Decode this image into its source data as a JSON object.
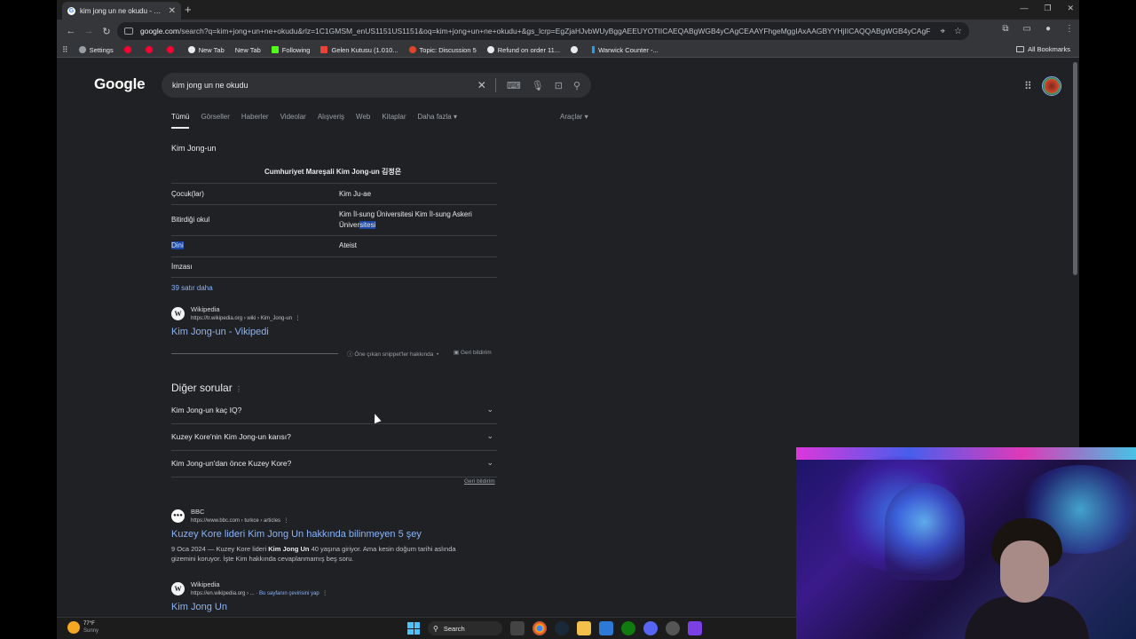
{
  "browser": {
    "tab_title": "kim jong un ne okudu - Google S",
    "url_host": "google.com",
    "url_rest": "/search?q=kim+jong+un+ne+okudu&rlz=1C1GMSM_enUS1151US1151&oq=kim+jong+un+ne+okudu+&gs_lcrp=EgZjaHJvbWUyBggAEEUYOTIICAEQABgWGB4yCAgCEAAYFhgeMggIAxAAGBYYHjIICAQQABgWGB4yCAgFEAAYFhgeMgcIBhAAGO8FM...",
    "bookmarks": [
      {
        "label": "Settings",
        "color": "#9aa0a6"
      },
      {
        "label": "",
        "color": "#ff0033"
      },
      {
        "label": "",
        "color": "#ff0033"
      },
      {
        "label": "",
        "color": "#ff0033"
      },
      {
        "label": "New Tab",
        "color": "#e8eaed"
      },
      {
        "label": "New Tab",
        "color": "#35363a"
      },
      {
        "label": "Following",
        "color": "#53fc18"
      },
      {
        "label": "Gelen Kutusu (1.010...",
        "color": "#ea4335"
      },
      {
        "label": "Topic: Discussion 5",
        "color": "#e0452b"
      },
      {
        "label": "Refund on order 11...",
        "color": "#e8eaed"
      },
      {
        "label": "",
        "color": "#e8eaed"
      },
      {
        "label": "Warwick Counter -...",
        "color": "#1da1f2"
      }
    ],
    "all_bookmarks": "All Bookmarks"
  },
  "google": {
    "logo": "Google",
    "query": "kim jong un ne okudu",
    "tabs": [
      "Tümü",
      "Görseller",
      "Haberler",
      "Videolar",
      "Alışveriş",
      "Web",
      "Kitaplar",
      "Daha fazla ▾"
    ],
    "tools": "Araçlar ▾"
  },
  "knowledge": {
    "title": "Kim Jong-un",
    "subtitle": "Cumhuriyet Mareşali Kim Jong-un 김정은",
    "rows": [
      {
        "key": "Çocuk(lar)",
        "value": "Kim Ju-ae"
      },
      {
        "key": "Bitirdiği okul",
        "value_a": "Kim İl-sung Üniversitesi Kim İl-sung Askeri Üniver",
        "value_b": "sitesi"
      },
      {
        "key": "Dini",
        "value": "Ateist"
      },
      {
        "key": "İmzası",
        "value": ""
      }
    ],
    "more": "39 satır daha"
  },
  "source1": {
    "name": "Wikipedia",
    "cite": "https://tr.wikipedia.org › wiki › Kim_Jong-un",
    "link": "Kim Jong-un - Vikipedi"
  },
  "snippet_footer": {
    "about": "Öne çıkan snippet'ler hakkında",
    "feedback": "Geri bildirim"
  },
  "paa": {
    "title": "Diğer sorular",
    "questions": [
      "Kim Jong-un kaç IQ?",
      "Kuzey Kore'nin Kim Jong-un karısı?",
      "Kim Jong-un'dan önce Kuzey Kore?"
    ],
    "feedback": "Geri bildirim"
  },
  "source2": {
    "name": "BBC",
    "cite": "https://www.bbc.com › turkce › articles",
    "link": "Kuzey Kore lideri Kim Jong Un hakkında bilinmeyen 5 şey",
    "snippet_date": "9 Oca 2024 — Kuzey Kore lideri ",
    "snippet_bold": "Kim Jong Un",
    "snippet_rest": " 40 yaşına giriyor. Ama kesin doğum tarihi aslında gizemini koruyor. İşte Kim hakkında cevaplanmamış beş soru."
  },
  "source3": {
    "name": "Wikipedia",
    "cite": "https://en.wikipedia.org › ...",
    "translate": "Bu sayfanın çevirisini yap",
    "link": "Kim Jong Un"
  },
  "taskbar": {
    "temp": "77°F",
    "weather": "Sunny",
    "search": "Search"
  }
}
